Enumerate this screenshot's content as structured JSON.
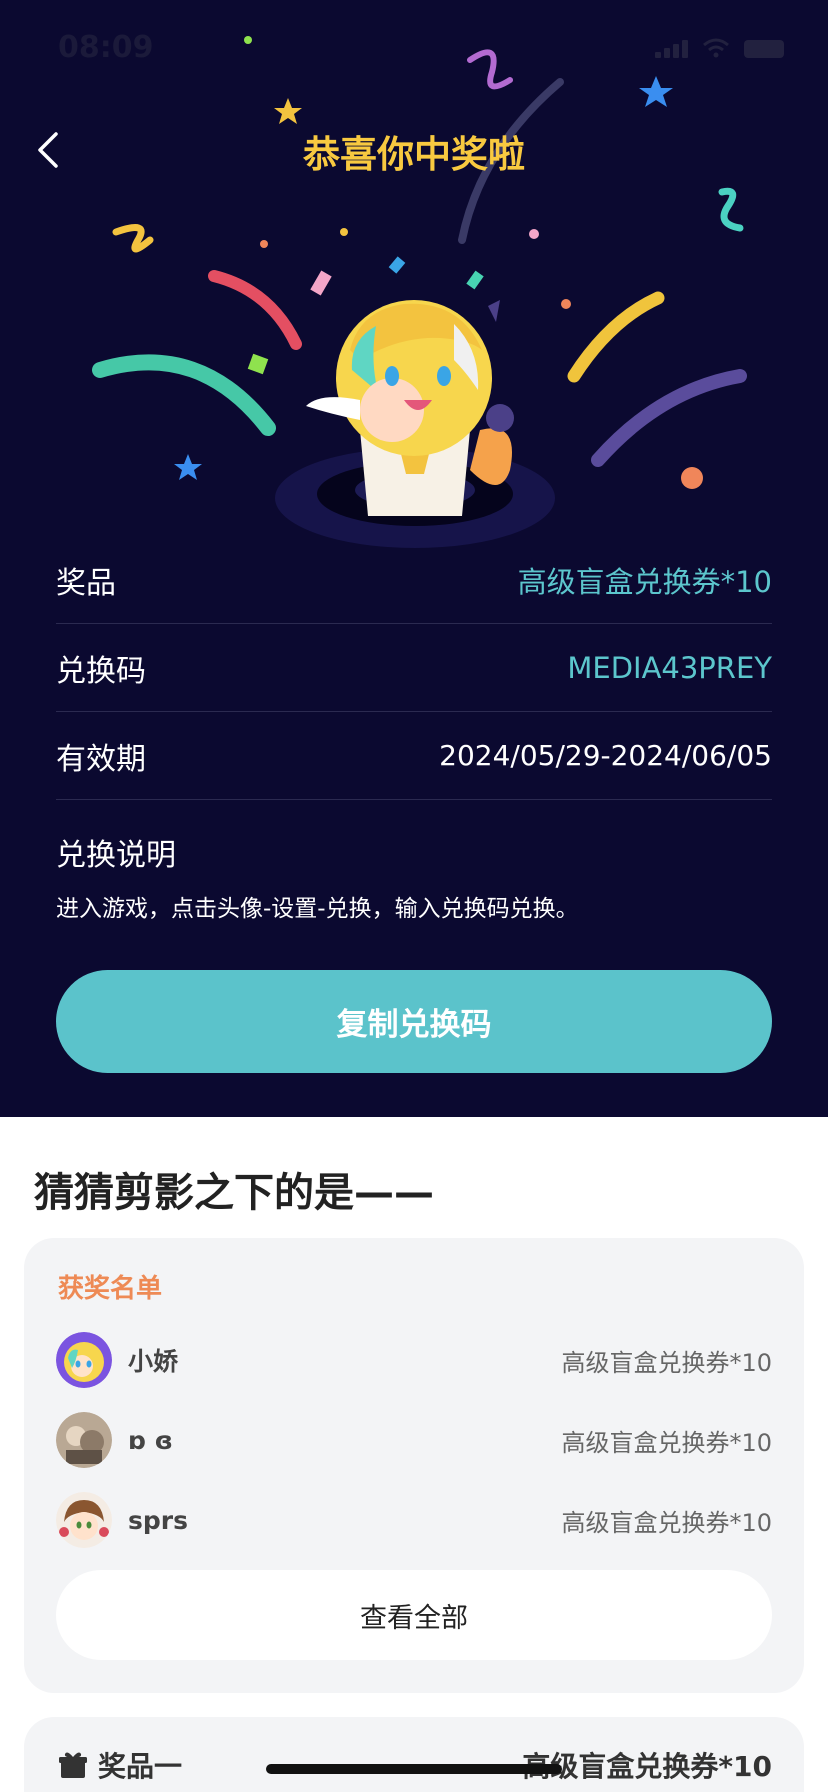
{
  "status_bar": {
    "time": "08:09"
  },
  "header": {
    "title": "恭喜你中奖啦"
  },
  "prize_info": {
    "rows": [
      {
        "label": "奖品",
        "value": "高级盲盒兑换券*10"
      },
      {
        "label": "兑换码",
        "value": "MEDIA43PREY"
      },
      {
        "label": "有效期",
        "value": "2024/05/29-2024/06/05"
      }
    ],
    "explain_title": "兑换说明",
    "explain_text": "进入游戏，点击头像-设置-兑换，输入兑换码兑换。",
    "copy_button": "复制兑换码"
  },
  "section": {
    "title": "猜猜剪影之下的是——",
    "winners_label": "获奖名单",
    "winners": [
      {
        "name": "小娇",
        "prize": "高级盲盒兑换券*10"
      },
      {
        "name": "ɒ ɞ",
        "prize": "高级盲盒兑换券*10"
      },
      {
        "name": "sprs",
        "prize": "高级盲盒兑换券*10"
      }
    ],
    "view_all": "查看全部"
  },
  "prize_one": {
    "label": "奖品一",
    "value": "高级盲盒兑换券*10"
  },
  "colors": {
    "dark_bg": "#0b0930",
    "accent_teal": "#5bc3cb",
    "title_gold": "#f8c940",
    "winners_orange": "#ee8a55"
  }
}
